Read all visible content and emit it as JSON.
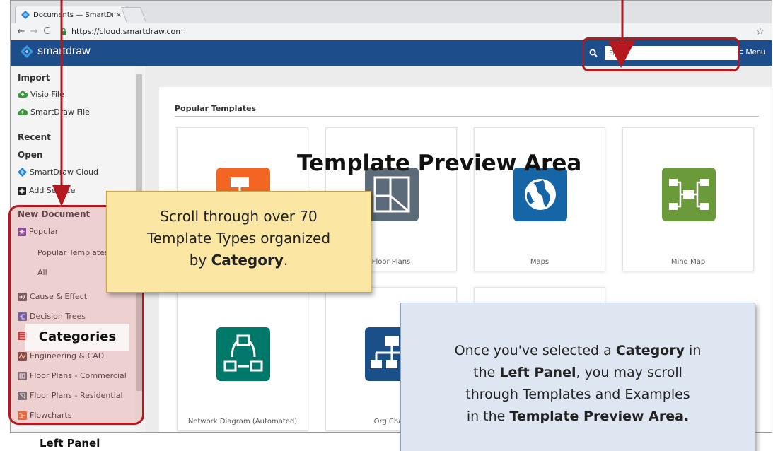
{
  "browser": {
    "tab_title": "Documents — SmartDra",
    "tab_close": "×",
    "url": "https://cloud.smartdraw.com",
    "back": "←",
    "forward": "→",
    "reload": "C",
    "bookmark": "☆"
  },
  "app": {
    "logo_text": "smartdraw",
    "search_placeholder": "Fi",
    "menu_label": "≡ Menu"
  },
  "sidebar": {
    "import_heading": "Import",
    "import_items": [
      "Visio File",
      "SmartDraw File"
    ],
    "recent_heading": "Recent",
    "open_heading": "Open",
    "open_items": [
      "SmartDraw Cloud",
      "Add Service"
    ],
    "new_doc_heading": "New Document",
    "popular": "Popular",
    "popular_subitems": [
      "Popular Templates",
      "All"
    ],
    "categories": [
      "Cause & Effect",
      "Decision Trees",
      "Engineering & CAD",
      "Floor Plans - Commercial",
      "Floor Plans - Residential",
      "Flowcharts"
    ]
  },
  "main": {
    "section_title": "Popular Templates",
    "cards": [
      {
        "label": "",
        "icon": "flowchart-icon",
        "color": "#f26522"
      },
      {
        "label": "Floor Plans",
        "icon": "floor-plan-icon",
        "color": "#5c6b7a"
      },
      {
        "label": "Maps",
        "icon": "globe-icon",
        "color": "#1565a7"
      },
      {
        "label": "Mind Map",
        "icon": "mind-map-icon",
        "color": "#6b9a3a"
      },
      {
        "label": "Network Diagram (Automated)",
        "icon": "network-diagram-icon",
        "color": "#00796b"
      },
      {
        "label": "Org Chart",
        "icon": "org-chart-icon",
        "color": "#1b4f8a"
      }
    ]
  },
  "annotations": {
    "preview_title": "Template Preview Area",
    "yellow_line1": "Scroll through over 70",
    "yellow_line2": "Template Types organized",
    "yellow_line3_prefix": "by ",
    "yellow_line3_bold": "Category",
    "yellow_line3_suffix": ".",
    "blue_line1_prefix": "Once you've selected a  ",
    "blue_line1_bold": "Category",
    "blue_line1_suffix": " in",
    "blue_line2_prefix": "the ",
    "blue_line2_bold": "Left Panel",
    "blue_line2_suffix": ", you may scroll",
    "blue_line3": "through Templates and Examples",
    "blue_line4_prefix": "in the ",
    "blue_line4_bold": "Template Preview Area.",
    "categories_tag": "Categories",
    "left_panel_label": "Left Panel"
  },
  "colors": {
    "header": "#1e4d8c",
    "annotation_red": "#b3191f",
    "yellow_callout": "#fbe7a3",
    "blue_callout": "#dde6f1",
    "cloud_green": "#3a9a3a"
  }
}
